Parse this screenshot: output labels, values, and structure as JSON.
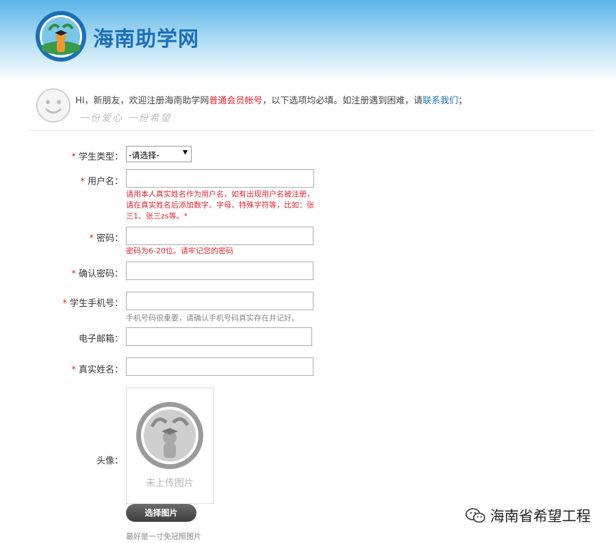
{
  "header": {
    "logo_text": "海南助学网"
  },
  "greeting": {
    "prefix": "Hi，新朋友，欢迎注册海南助学网",
    "highlight": "普通会员帐号",
    "middle": "，以下选项均必填。如注册遇到困难，请",
    "link": "联系我们",
    "suffix": "；",
    "slogan": "一份爱心  一份希望"
  },
  "form": {
    "required_mark": "*",
    "student_type": {
      "label": "学生类型：",
      "value": "-请选择-"
    },
    "username": {
      "label": "用户名：",
      "value": "",
      "hint": "请用本人真实姓名作为用户名，如有出现用户名被注册，请在真实姓名后添加数字、字母、特殊字符等，比如：张三1、张三zs等。*"
    },
    "password": {
      "label": "密码：",
      "value": "",
      "hint": "密码为6-20位。请牢记您的密码"
    },
    "confirm_password": {
      "label": "确认密码：",
      "value": ""
    },
    "phone": {
      "label": "学生手机号：",
      "value": "",
      "hint": "手机号码很重要，请确认手机号码真实存在并记好。"
    },
    "email": {
      "label": "电子邮箱：",
      "value": ""
    },
    "real_name": {
      "label": "真实姓名：",
      "value": ""
    },
    "avatar": {
      "label": "头像：",
      "placeholder_caption": "未上传图片",
      "button": "选择图片",
      "hint": "最好是一寸免冠照图片"
    }
  },
  "watermark": {
    "text": "海南省希望工程",
    "icon": "wechat-icon"
  },
  "colors": {
    "brand_blue": "#1d6fb4",
    "required_red": "#e0262f",
    "sky": "#5ab4e8"
  }
}
